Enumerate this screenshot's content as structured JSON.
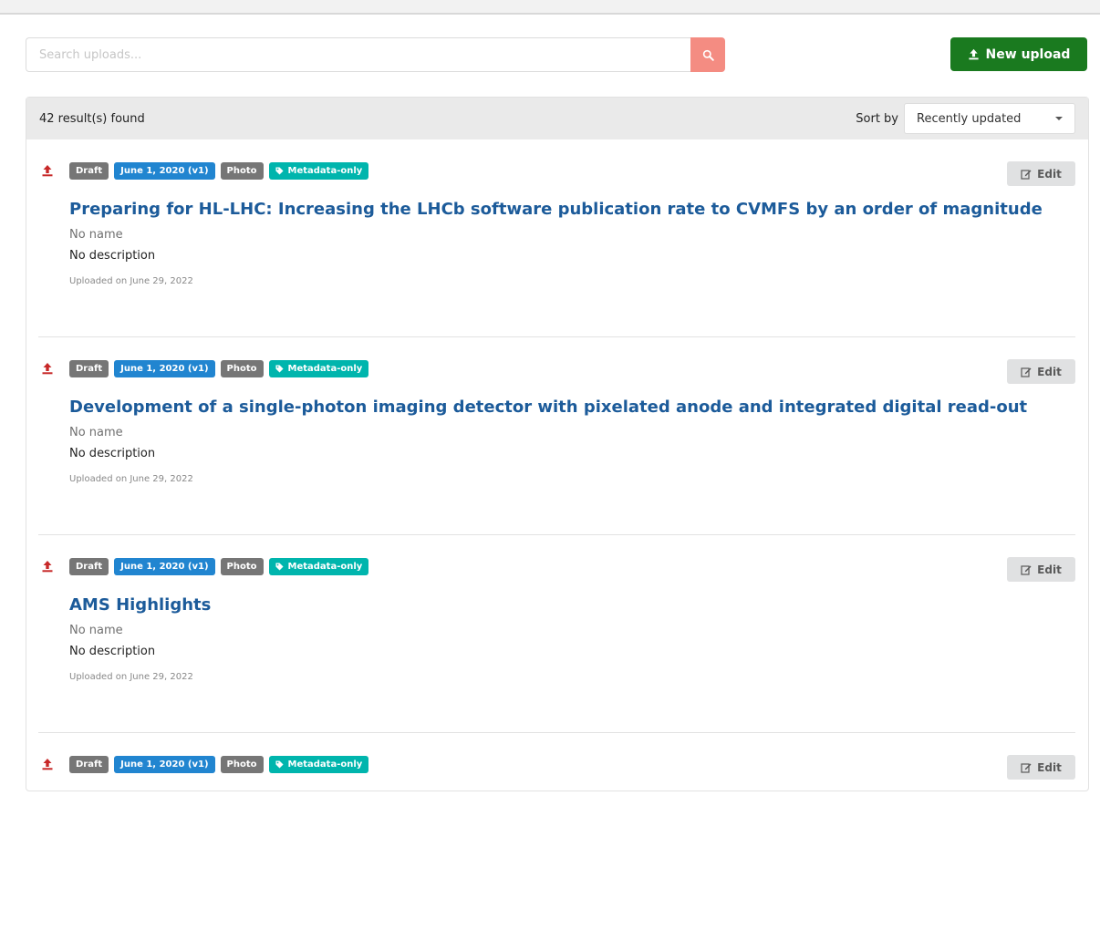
{
  "search": {
    "placeholder": "Search uploads..."
  },
  "toolbar": {
    "new_upload_label": "New upload"
  },
  "results": {
    "count_text": "42 result(s) found",
    "sort_label": "Sort by",
    "sort_value": "Recently updated"
  },
  "items": [
    {
      "status": "Draft",
      "version": "June 1, 2020 (v1)",
      "type": "Photo",
      "access": "Metadata-only",
      "title": "Preparing for HL-LHC: Increasing the LHCb software publication rate to CVMFS by an order of magnitude",
      "creator": "No name",
      "description": "No description",
      "uploaded": "Uploaded on June 29, 2022",
      "edit_label": "Edit"
    },
    {
      "status": "Draft",
      "version": "June 1, 2020 (v1)",
      "type": "Photo",
      "access": "Metadata-only",
      "title": "Development of a single-photon imaging detector with pixelated anode and integrated digital read-out",
      "creator": "No name",
      "description": "No description",
      "uploaded": "Uploaded on June 29, 2022",
      "edit_label": "Edit"
    },
    {
      "status": "Draft",
      "version": "June 1, 2020 (v1)",
      "type": "Photo",
      "access": "Metadata-only",
      "title": "AMS Highlights",
      "creator": "No name",
      "description": "No description",
      "uploaded": "Uploaded on June 29, 2022",
      "edit_label": "Edit"
    },
    {
      "status": "Draft",
      "version": "June 1, 2020 (v1)",
      "type": "Photo",
      "access": "Metadata-only",
      "title": "",
      "creator": "",
      "description": "",
      "uploaded": "",
      "edit_label": "Edit"
    }
  ],
  "icons": {
    "search": "search-icon",
    "upload": "upload-icon",
    "tag": "tag-icon",
    "edit": "edit-icon",
    "caret": "chevron-down-icon"
  },
  "colors": {
    "primary_green": "#1a7a1f",
    "search_button": "#f48c82",
    "title_blue": "#1c5b9a",
    "label_gray": "#767676",
    "label_blue": "#2185d0",
    "label_teal": "#00b5ad",
    "upload_red": "#c72828"
  }
}
